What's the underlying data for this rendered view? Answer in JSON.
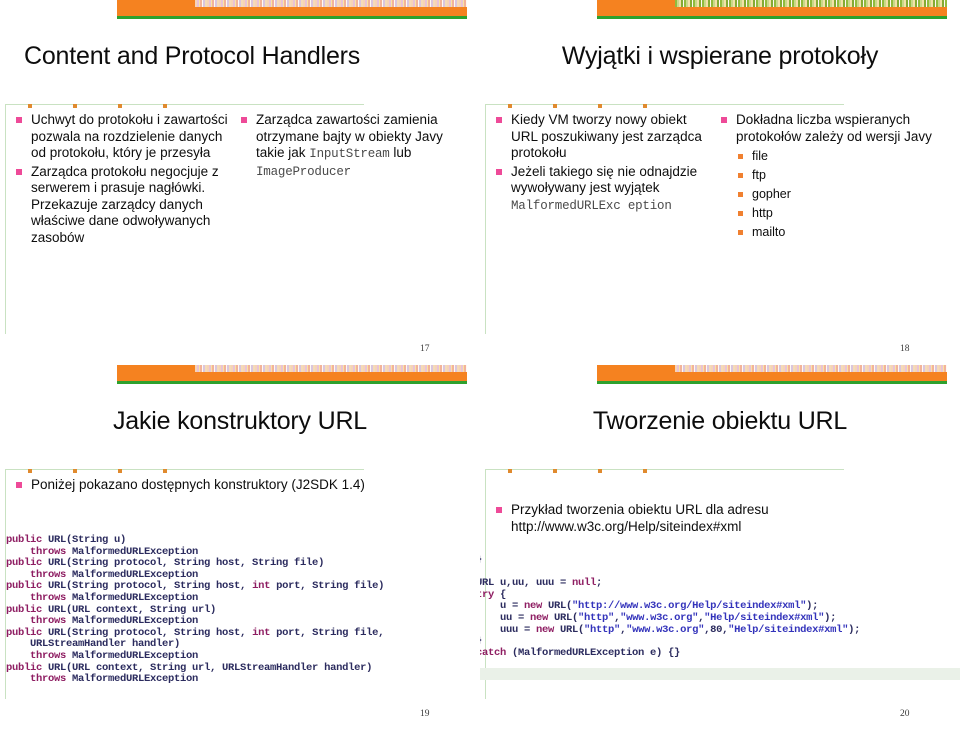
{
  "deck": {
    "theme": {
      "band_orange": "#F58220",
      "band_green": "#2EA12E",
      "rule_green": "#c9e2c2",
      "bullet_pink": "#EE4A98",
      "bullet_orange": "#F08030",
      "code_keyword": "#8E1D62",
      "code_string": "#3333BB",
      "code_body": "#2b2b5e"
    }
  },
  "slides": [
    {
      "id": "slide-17",
      "title": "Content and Protocol Handlers",
      "page_number": "17",
      "columns": [
        {
          "bullets": [
            {
              "text": "Uchwyt do protokołu i zawartości pozwala na rozdzielenie danych od protokołu, który je przesyła"
            },
            {
              "text": "Zarządca protokołu negocjuje z serwerem i prasuje nagłówki. Przekazuje zarządcy danych właściwe dane odwoływanych zasobów"
            }
          ]
        },
        {
          "bullets": [
            {
              "text": "Zarządca zawartości zamienia otrzymane bajty w obiekty Javy takie jak ",
              "mono1": "InputStream",
              "mid": " lub ",
              "mono2": "ImageProducer"
            }
          ]
        }
      ]
    },
    {
      "id": "slide-18",
      "title": "Wyjątki i wspierane protokoły",
      "page_number": "18",
      "columns": [
        {
          "bullets": [
            {
              "text": "Kiedy VM tworzy nowy obiekt URL poszukiwany jest zarządca protokołu"
            },
            {
              "text": "Jeżeli takiego się nie odnajdzie wywoływany jest wyjątek ",
              "mono1": "MalformedURLExc eption"
            }
          ]
        },
        {
          "bullets": [
            {
              "text": "Dokładna liczba wspieranych protokołów zależy od wersji Javy",
              "sub": [
                "file",
                "ftp",
                "gopher",
                "http",
                "mailto"
              ]
            }
          ]
        }
      ]
    },
    {
      "id": "slide-19",
      "title": "Jakie konstruktory URL",
      "page_number": "19",
      "columns": [
        {
          "bullets": [
            {
              "text": "Poniżej pokazano dostępnych konstruktory (J2SDK 1.4)"
            }
          ]
        }
      ],
      "code_lines": [
        [
          {
            "t": "public",
            "k": 1
          },
          {
            "t": " URL(String u)"
          }
        ],
        [
          {
            "t": "    "
          },
          {
            "t": "throws",
            "k": 1
          },
          {
            "t": " MalformedURLException"
          }
        ],
        [
          {
            "t": "public",
            "k": 1
          },
          {
            "t": " URL(String protocol, String host, String file)"
          }
        ],
        [
          {
            "t": "    "
          },
          {
            "t": "throws",
            "k": 1
          },
          {
            "t": " MalformedURLException"
          }
        ],
        [
          {
            "t": "public",
            "k": 1
          },
          {
            "t": " URL(String protocol, String host, "
          },
          {
            "t": "int",
            "k": 1
          },
          {
            "t": " port, String file)"
          }
        ],
        [
          {
            "t": "    "
          },
          {
            "t": "throws",
            "k": 1
          },
          {
            "t": " MalformedURLException"
          }
        ],
        [
          {
            "t": "public",
            "k": 1
          },
          {
            "t": " URL(URL context, String url)"
          }
        ],
        [
          {
            "t": "    "
          },
          {
            "t": "throws",
            "k": 1
          },
          {
            "t": " MalformedURLException"
          }
        ],
        [
          {
            "t": "public",
            "k": 1
          },
          {
            "t": " URL(String protocol, String host, "
          },
          {
            "t": "int",
            "k": 1
          },
          {
            "t": " port, String file,"
          }
        ],
        [
          {
            "t": "    URLStreamHandler handler)"
          }
        ],
        [
          {
            "t": "    "
          },
          {
            "t": "throws",
            "k": 1
          },
          {
            "t": " MalformedURLException"
          }
        ],
        [
          {
            "t": "public",
            "k": 1
          },
          {
            "t": " URL(URL context, String url, URLStreamHandler handler)"
          }
        ],
        [
          {
            "t": "    "
          },
          {
            "t": "throws",
            "k": 1
          },
          {
            "t": " MalformedURLException"
          }
        ]
      ]
    },
    {
      "id": "slide-20",
      "title": "Tworzenie obiektu URL",
      "page_number": "20",
      "columns": [
        {
          "bullets": [
            {
              "text": "Przykład tworzenia obiektu URL dla adresu http://www.w3c.org/Help/siteindex#xml"
            }
          ]
        }
      ],
      "code_lines": [
        [
          {
            "t": "}"
          }
        ],
        [
          {
            "t": ""
          }
        ],
        [
          {
            "t": "URL u,uu, uuu = "
          },
          {
            "t": "null",
            "k": 1
          },
          {
            "t": ";"
          }
        ],
        [
          {
            "t": "try",
            "k": 1
          },
          {
            "t": " {"
          }
        ],
        [
          {
            "t": "    u = "
          },
          {
            "t": "new",
            "k": 1
          },
          {
            "t": " URL("
          },
          {
            "t": "\"http://www.w3c.org/Help/siteindex#xml\"",
            "s": 1
          },
          {
            "t": ");"
          }
        ],
        [
          {
            "t": "    uu = "
          },
          {
            "t": "new",
            "k": 1
          },
          {
            "t": " URL("
          },
          {
            "t": "\"http\"",
            "s": 1
          },
          {
            "t": ","
          },
          {
            "t": "\"www.w3c.org\"",
            "s": 1
          },
          {
            "t": ","
          },
          {
            "t": "\"Help/siteindex#xml\"",
            "s": 1
          },
          {
            "t": ");"
          }
        ],
        [
          {
            "t": "    uuu = "
          },
          {
            "t": "new",
            "k": 1
          },
          {
            "t": " URL("
          },
          {
            "t": "\"http\"",
            "s": 1
          },
          {
            "t": ","
          },
          {
            "t": "\"www.w3c.org\"",
            "s": 1
          },
          {
            "t": ",80,"
          },
          {
            "t": "\"Help/siteindex#xml\"",
            "s": 1
          },
          {
            "t": ");"
          }
        ],
        [
          {
            "t": "}"
          }
        ],
        [
          {
            "t": "catch",
            "k": 1
          },
          {
            "t": " (MalformedURLException e) {}"
          }
        ]
      ]
    }
  ]
}
